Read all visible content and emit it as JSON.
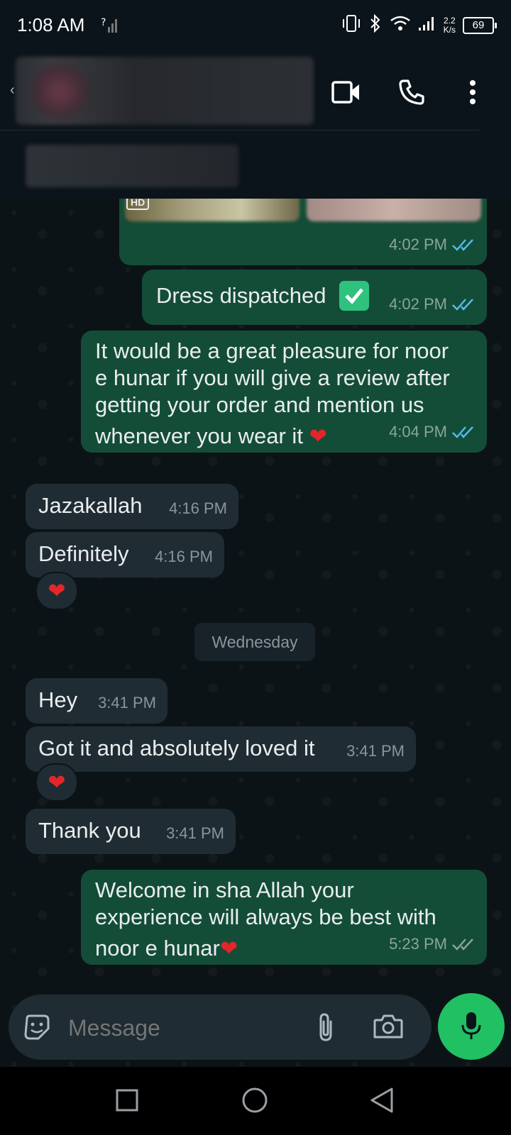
{
  "status_bar": {
    "time": "1:08 AM",
    "net_speed_top": "2.2",
    "net_speed_bottom": "K/s",
    "battery": "69"
  },
  "chat_header": {
    "contact_name": "",
    "icons": [
      "back-icon",
      "video-call-icon",
      "voice-call-icon",
      "more-options-icon"
    ]
  },
  "media_message": {
    "badge": "HD",
    "time": "4:02 PM"
  },
  "messages": [
    {
      "direction": "out",
      "text": "Dress dispatched",
      "emoji": "check-mark-button-icon",
      "time": "4:02 PM",
      "status": "read"
    },
    {
      "direction": "out",
      "text_lines": [
        "It would be a great pleasure for noor",
        "e hunar if you will give a review after",
        "getting your order and mention us",
        "whenever you wear it"
      ],
      "emoji": "heart-icon",
      "time": "4:04 PM",
      "status": "read"
    },
    {
      "direction": "in",
      "text": "Jazakallah",
      "time": "4:16 PM"
    },
    {
      "direction": "in",
      "text": "Definitely",
      "time": "4:16 PM",
      "reaction": "heart-icon"
    },
    {
      "direction": "in",
      "text": "Hey",
      "time": "3:41 PM"
    },
    {
      "direction": "in",
      "text": "Got it and absolutely loved it",
      "time": "3:41 PM",
      "reaction": "heart-icon"
    },
    {
      "direction": "in",
      "text": "Thank you",
      "time": "3:41 PM"
    },
    {
      "direction": "out",
      "text_lines": [
        "Welcome in sha Allah your",
        "experience will always be best with",
        "noor e hunar"
      ],
      "emoji": "heart-icon",
      "time": "5:23 PM",
      "status": "delivered"
    }
  ],
  "day_separator": "Wednesday",
  "composer": {
    "placeholder": "Message"
  },
  "colors": {
    "outgoing_bubble": "#144d37",
    "incoming_bubble": "#202c33",
    "read_tick": "#53bdeb",
    "mic_button": "#21c063",
    "background": "#0c1317"
  }
}
